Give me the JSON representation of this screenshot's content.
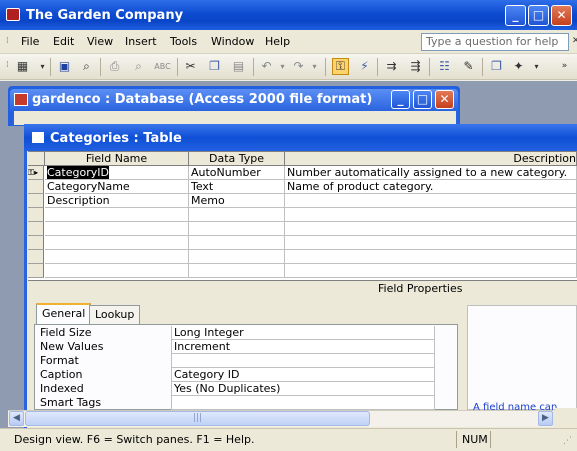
{
  "app": {
    "title": "The Garden Company"
  },
  "menu": {
    "items": [
      "File",
      "Edit",
      "View",
      "Insert",
      "Tools",
      "Window",
      "Help"
    ],
    "help_placeholder": "Type a question for help"
  },
  "db_window": {
    "title": "gardenco : Database (Access 2000 file format)"
  },
  "table_window": {
    "title": "Categories : Table"
  },
  "grid": {
    "headers": [
      "Field Name",
      "Data Type",
      "Description"
    ],
    "rows": [
      {
        "field": "CategoryID",
        "type": "AutoNumber",
        "description": "Number automatically assigned to a new category."
      },
      {
        "field": "CategoryName",
        "type": "Text",
        "description": "Name of product category."
      },
      {
        "field": "Description",
        "type": "Memo",
        "description": ""
      }
    ]
  },
  "field_properties": {
    "label": "Field Properties",
    "tabs": [
      "General",
      "Lookup"
    ],
    "properties": [
      {
        "label": "Field Size",
        "value": "Long Integer"
      },
      {
        "label": "New Values",
        "value": "Increment"
      },
      {
        "label": "Format",
        "value": ""
      },
      {
        "label": "Caption",
        "value": "Category ID"
      },
      {
        "label": "Indexed",
        "value": "Yes (No Duplicates)"
      },
      {
        "label": "Smart Tags",
        "value": ""
      }
    ],
    "help_text": "A field name can"
  },
  "status": {
    "text": "Design view.  F6 = Switch panes.  F1 = Help.",
    "num": "NUM"
  },
  "icons": {
    "window_controls": [
      "minimize-icon",
      "maximize-icon",
      "close-icon"
    ],
    "primary_key": "key-icon"
  }
}
